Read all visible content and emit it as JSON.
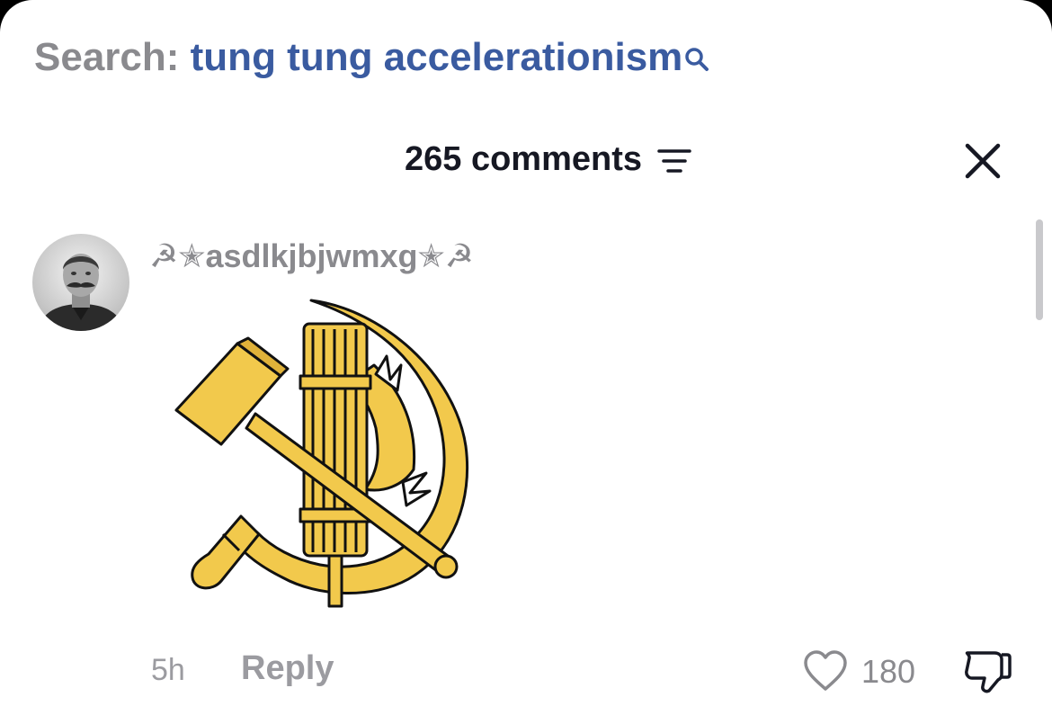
{
  "search": {
    "prefix": "Search:",
    "query": "tung tung accelerationism",
    "icon": "search-icon"
  },
  "comments_header": {
    "count_label": "265 comments",
    "sort_icon": "sort-lines-icon",
    "close_icon": "close-icon"
  },
  "comment": {
    "username": "☭✭asdlkjbjwmxg✭☭",
    "avatar": "avatar",
    "image": "emblem-sticker",
    "time": "5h",
    "reply_label": "Reply",
    "likes": "180",
    "like_icon": "heart-icon",
    "dislike_icon": "thumbs-down-icon"
  },
  "colors": {
    "query_blue": "#3a5ba0",
    "muted_gray": "#8a8a8e",
    "emblem_gold": "#f2c94c"
  }
}
